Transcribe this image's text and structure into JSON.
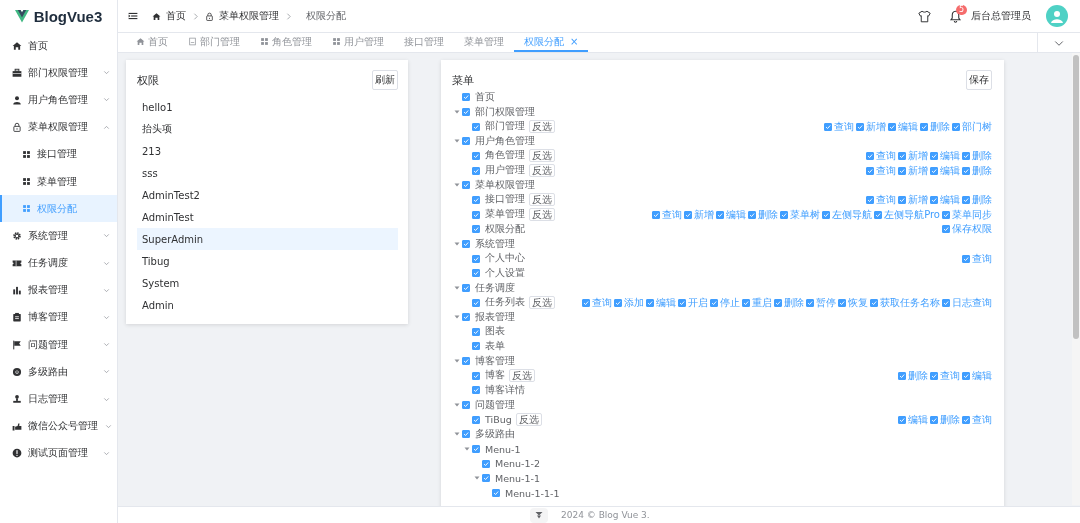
{
  "logo": {
    "title": "BlogVue3"
  },
  "sidebar": {
    "items": [
      {
        "label": "首页",
        "selected": false
      },
      {
        "label": "部门权限管理",
        "selected": false,
        "expanded": false
      },
      {
        "label": "用户角色管理",
        "selected": false,
        "expanded": false
      },
      {
        "label": "菜单权限管理",
        "selected": false,
        "expanded": true,
        "children": [
          {
            "label": "接口管理",
            "selected": false
          },
          {
            "label": "菜单管理",
            "selected": false
          },
          {
            "label": "权限分配",
            "selected": true
          }
        ]
      },
      {
        "label": "系统管理",
        "selected": false,
        "expanded": false
      },
      {
        "label": "任务调度",
        "selected": false,
        "expanded": false
      },
      {
        "label": "报表管理",
        "selected": false,
        "expanded": false
      },
      {
        "label": "博客管理",
        "selected": false,
        "expanded": false
      },
      {
        "label": "问题管理",
        "selected": false,
        "expanded": false
      },
      {
        "label": "多级路由",
        "selected": false,
        "expanded": false
      },
      {
        "label": "日志管理",
        "selected": false,
        "expanded": false
      },
      {
        "label": "微信公众号管理",
        "selected": false,
        "expanded": false
      },
      {
        "label": "测试页面管理",
        "selected": false,
        "expanded": false
      }
    ]
  },
  "header": {
    "breadcrumbs": [
      "首页",
      "菜单权限管理",
      "权限分配"
    ],
    "notification_count": "5",
    "user_name": "后台总管理员"
  },
  "tabs": [
    {
      "label": "首页",
      "selected": false
    },
    {
      "label": "部门管理",
      "selected": false
    },
    {
      "label": "角色管理",
      "selected": false
    },
    {
      "label": "用户管理",
      "selected": false
    },
    {
      "label": "接口管理",
      "selected": false
    },
    {
      "label": "菜单管理",
      "selected": false
    },
    {
      "label": "权限分配",
      "selected": true,
      "close_icon": "×"
    }
  ],
  "roles_panel": {
    "title": "权限",
    "refresh_button": "刷新",
    "roles": [
      {
        "label": "hello1",
        "selected": false
      },
      {
        "label": "抬头项",
        "selected": false
      },
      {
        "label": "213",
        "selected": false
      },
      {
        "label": "sss",
        "selected": false
      },
      {
        "label": "AdminTest2",
        "selected": false
      },
      {
        "label": "AdminTest",
        "selected": false
      },
      {
        "label": "SuperAdmin",
        "selected": true
      },
      {
        "label": "Tibug",
        "selected": false
      },
      {
        "label": "System",
        "selected": false
      },
      {
        "label": "Admin",
        "selected": false
      }
    ]
  },
  "menu_panel": {
    "title": "菜单",
    "save_button": "保存",
    "tree": [
      {
        "label": "首页",
        "checked": true
      },
      {
        "label": "部门权限管理",
        "checked": true,
        "expanded": true,
        "children": [
          {
            "label": "部门管理",
            "checked": true,
            "invert_button": "反选",
            "perms": [
              {
                "label": "查询",
                "checked": true
              },
              {
                "label": "新增",
                "checked": true
              },
              {
                "label": "编辑",
                "checked": true
              },
              {
                "label": "删除",
                "checked": true
              },
              {
                "label": "部门树",
                "checked": true
              }
            ]
          }
        ]
      },
      {
        "label": "用户角色管理",
        "checked": true,
        "expanded": true,
        "children": [
          {
            "label": "角色管理",
            "checked": true,
            "invert_button": "反选",
            "perms": [
              {
                "label": "查询",
                "checked": true
              },
              {
                "label": "新增",
                "checked": true
              },
              {
                "label": "编辑",
                "checked": true
              },
              {
                "label": "删除",
                "checked": true
              }
            ]
          },
          {
            "label": "用户管理",
            "checked": true,
            "invert_button": "反选",
            "perms": [
              {
                "label": "查询",
                "checked": true
              },
              {
                "label": "新增",
                "checked": true
              },
              {
                "label": "编辑",
                "checked": true
              },
              {
                "label": "删除",
                "checked": true
              }
            ]
          }
        ]
      },
      {
        "label": "菜单权限管理",
        "checked": true,
        "expanded": true,
        "children": [
          {
            "label": "接口管理",
            "checked": true,
            "invert_button": "反选",
            "perms": [
              {
                "label": "查询",
                "checked": true
              },
              {
                "label": "新增",
                "checked": true
              },
              {
                "label": "编辑",
                "checked": true
              },
              {
                "label": "删除",
                "checked": true
              }
            ]
          },
          {
            "label": "菜单管理",
            "checked": true,
            "invert_button": "反选",
            "perms": [
              {
                "label": "查询",
                "checked": true
              },
              {
                "label": "新增",
                "checked": true
              },
              {
                "label": "编辑",
                "checked": true
              },
              {
                "label": "删除",
                "checked": true
              },
              {
                "label": "菜单树",
                "checked": true
              },
              {
                "label": "左侧导航",
                "checked": true
              },
              {
                "label": "左侧导航Pro",
                "checked": true
              },
              {
                "label": "菜单同步",
                "checked": true
              }
            ]
          },
          {
            "label": "权限分配",
            "checked": true,
            "perms": [
              {
                "label": "保存权限",
                "checked": true
              }
            ]
          }
        ]
      },
      {
        "label": "系统管理",
        "checked": true,
        "expanded": true,
        "children": [
          {
            "label": "个人中心",
            "checked": true,
            "perms": [
              {
                "label": "查询",
                "checked": true
              }
            ]
          },
          {
            "label": "个人设置",
            "checked": true
          }
        ]
      },
      {
        "label": "任务调度",
        "checked": true,
        "expanded": true,
        "children": [
          {
            "label": "任务列表",
            "checked": true,
            "invert_button": "反选",
            "perms": [
              {
                "label": "查询",
                "checked": true
              },
              {
                "label": "添加",
                "checked": true
              },
              {
                "label": "编辑",
                "checked": true
              },
              {
                "label": "开启",
                "checked": true
              },
              {
                "label": "停止",
                "checked": true
              },
              {
                "label": "重启",
                "checked": true
              },
              {
                "label": "删除",
                "checked": true
              },
              {
                "label": "暂停",
                "checked": true
              },
              {
                "label": "恢复",
                "checked": true
              },
              {
                "label": "获取任务名称",
                "checked": true
              },
              {
                "label": "日志查询",
                "checked": true
              }
            ]
          }
        ]
      },
      {
        "label": "报表管理",
        "checked": true,
        "expanded": true,
        "children": [
          {
            "label": "图表",
            "checked": true
          },
          {
            "label": "表单",
            "checked": true
          }
        ]
      },
      {
        "label": "博客管理",
        "checked": true,
        "expanded": true,
        "children": [
          {
            "label": "博客",
            "checked": true,
            "invert_button": "反选",
            "perms": [
              {
                "label": "删除",
                "checked": true
              },
              {
                "label": "查询",
                "checked": true
              },
              {
                "label": "编辑",
                "checked": true
              }
            ]
          },
          {
            "label": "博客详情",
            "checked": true
          }
        ]
      },
      {
        "label": "问题管理",
        "checked": true,
        "expanded": true,
        "children": [
          {
            "label": "TiBug",
            "checked": true,
            "invert_button": "反选",
            "perms": [
              {
                "label": "编辑",
                "checked": true
              },
              {
                "label": "删除",
                "checked": true
              },
              {
                "label": "查询",
                "checked": true
              }
            ]
          }
        ]
      },
      {
        "label": "多级路由",
        "checked": true,
        "expanded": true,
        "children": [
          {
            "label": "Menu-1",
            "checked": true,
            "expanded": true,
            "children": [
              {
                "label": "Menu-1-2",
                "checked": true
              },
              {
                "label": "Menu-1-1",
                "checked": true,
                "expanded": true,
                "children": [
                  {
                    "label": "Menu-1-1-1",
                    "checked": true
                  }
                ]
              }
            ]
          }
        ]
      }
    ]
  },
  "footer": {
    "text": "2024 © Blog Vue 3."
  }
}
